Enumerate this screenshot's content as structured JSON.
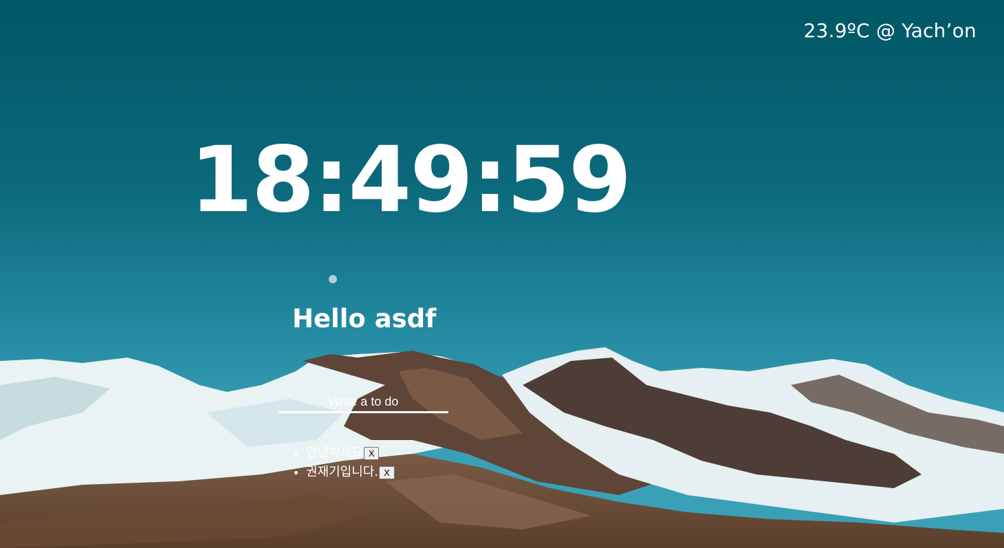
{
  "weather": {
    "text": "23.9ºC @ Yach’on"
  },
  "clock": {
    "time": "18:49:59"
  },
  "greeting": {
    "text": "Hello asdf"
  },
  "todo": {
    "placeholder": "Write a to do",
    "items": [
      {
        "label": "안녕하세요",
        "delete_label": "X"
      },
      {
        "label": "권재기입니다.",
        "delete_label": "X"
      }
    ]
  },
  "colors": {
    "sky_top": "#005766",
    "sky_bottom": "#3aa0b8",
    "text": "#ffffff"
  }
}
